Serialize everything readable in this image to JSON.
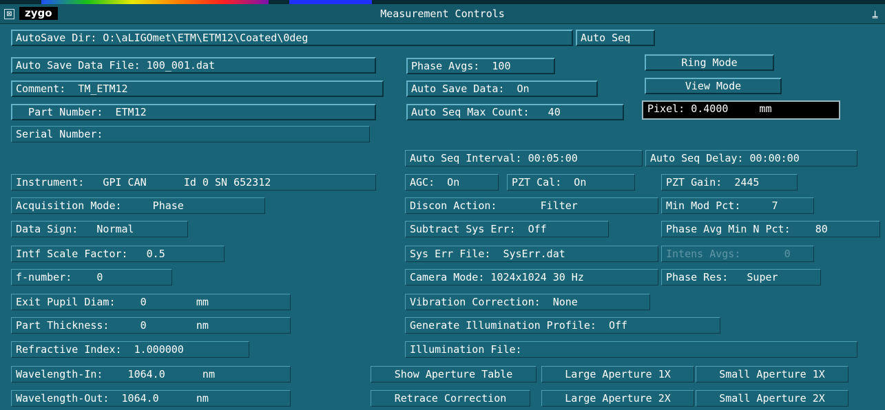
{
  "window": {
    "title": "Measurement Controls",
    "logo": "zygo",
    "menu_icon": "window-menu-icon",
    "pin_icon": "pin-icon",
    "pin_glyph": "⍊",
    "menu_glyph": "⊠"
  },
  "fields": {
    "autosave_dir": "AutoSave Dir: O:\\aLIGOmet\\ETM\\ETM12\\Coated\\0deg",
    "auto_seq": "Auto Seq",
    "auto_save_data_file": "Auto Save Data File: 100_001.dat",
    "comment": "Comment:  TM_ETM12",
    "part_number": "  Part Number:  ETM12",
    "serial_number": "Serial Number:",
    "phase_avgs": "Phase Avgs:  100",
    "auto_save_data": "Auto Save Data:  On",
    "auto_seq_max_count": "Auto Seq Max Count:   40",
    "ring_mode": "Ring Mode",
    "view_mode": "View Mode",
    "pixel": "Pixel: 0.4000     mm",
    "auto_seq_interval": "Auto Seq Interval: 00:05:00",
    "auto_seq_delay": "Auto Seq Delay: 00:00:00",
    "instrument": "Instrument:   GPI CAN      Id 0 SN 652312",
    "agc": "AGC:  On",
    "pzt_cal": "PZT Cal:  On",
    "pzt_gain": "PZT Gain:  2445",
    "acquisition_mode": "Acquisition Mode:     Phase",
    "discon_action": "Discon Action:       Filter",
    "min_mod_pct": "Min Mod Pct:     7",
    "data_sign": "Data Sign:   Normal",
    "subtract_sys_err": "Subtract Sys Err:  Off",
    "phase_avg_min_n_pct": "Phase Avg Min N Pct:    80",
    "intf_scale_factor": "Intf Scale Factor:   0.5",
    "sys_err_file": "Sys Err File:  SysErr.dat",
    "intens_avgs": "Intens Avgs:       0",
    "f_number": "f-number:    0",
    "camera_mode": "Camera Mode: 1024x1024 30 Hz",
    "phase_res": "Phase Res:   Super",
    "exit_pupil_diam": "Exit Pupil Diam:    0        mm",
    "vibration_correction": "Vibration Correction:  None",
    "part_thickness": "Part Thickness:     0        nm",
    "generate_illumination_profile": "Generate Illumination Profile:  Off",
    "refractive_index": "Refractive Index:  1.000000",
    "illumination_file": "Illumination File:",
    "wavelength_in": "Wavelength-In:    1064.0      nm",
    "wavelength_out": "Wavelength-Out:  1064.0      nm"
  },
  "buttons": {
    "show_aperture_table": "Show Aperture Table",
    "large_aperture_1x": "Large Aperture 1X",
    "small_aperture_1x": "Small Aperture 1X",
    "retrace_correction": "Retrace Correction",
    "large_aperture_2x": "Large Aperture 2X",
    "small_aperture_2x": "Small Aperture 2X"
  },
  "colors": {
    "background": "#1a6478",
    "pixel_box": "#000000",
    "disabled_text": "#5e97a6"
  }
}
